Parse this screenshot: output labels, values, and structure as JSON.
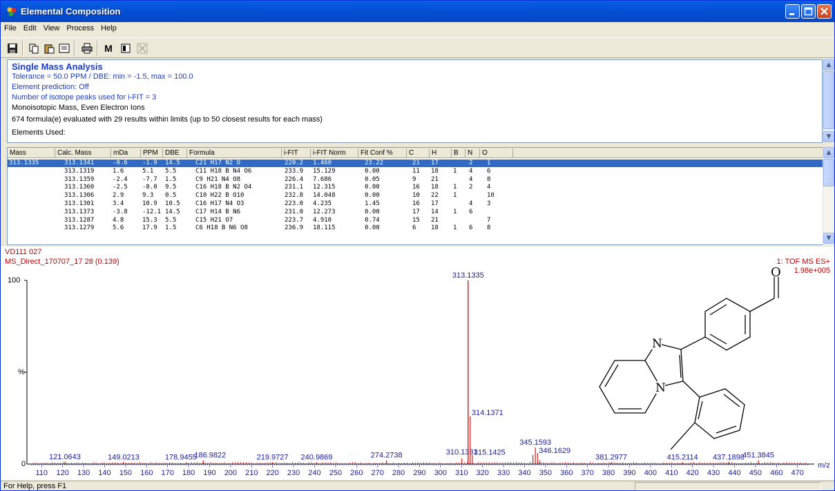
{
  "window": {
    "title": "Elemental Composition"
  },
  "menu": [
    "File",
    "Edit",
    "View",
    "Process",
    "Help"
  ],
  "toolbar": {
    "icons": [
      "save-icon",
      "copy-icon",
      "paste-icon",
      "properties-icon",
      "print-icon",
      "m-icon",
      "view-icon",
      "close-x-icon"
    ],
    "m_label": "M"
  },
  "info": {
    "title": "Single Mass Analysis",
    "tolerance": "Tolerance = 50.0 PPM   /   DBE: min = -1.5, max = 100.0",
    "prediction": "Element prediction: Off",
    "isotope": "Number of isotope peaks used for i-FIT = 3",
    "mode": "Monoisotopic Mass, Even Electron Ions",
    "summary": "674 formula(e) evaluated with 29 results within limits (up to 50 closest results for each mass)",
    "elements": "Elements Used:"
  },
  "grid": {
    "headers": [
      "Mass",
      "Calc. Mass",
      "mDa",
      "PPM",
      "DBE",
      "Formula",
      "i-FIT",
      "i-FIT Norm",
      "Fit Conf %",
      "C",
      "H",
      "B",
      "N",
      "O"
    ],
    "rows": [
      [
        "313.1335",
        "313.1341",
        "-0.6",
        "-1.9",
        "14.5",
        "C21 H17 N2 O",
        "220.2",
        "1.460",
        "23.22",
        "21",
        "17",
        "",
        "2",
        "1"
      ],
      [
        "",
        "313.1319",
        "1.6",
        "5.1",
        "5.5",
        "C11 H18 B N4 O6",
        "233.9",
        "15.129",
        "0.00",
        "11",
        "18",
        "1",
        "4",
        "6"
      ],
      [
        "",
        "313.1359",
        "-2.4",
        "-7.7",
        "1.5",
        "C9 H21 N4 O8",
        "226.4",
        "7.686",
        "0.05",
        "9",
        "21",
        "",
        "4",
        "8"
      ],
      [
        "",
        "313.1360",
        "-2.5",
        "-8.0",
        "9.5",
        "C16 H18 B N2 O4",
        "231.1",
        "12.315",
        "0.00",
        "16",
        "18",
        "1",
        "2",
        "4"
      ],
      [
        "",
        "313.1306",
        "2.9",
        "9.3",
        "0.5",
        "C10 H22 B O10",
        "232.8",
        "14.048",
        "0.00",
        "10",
        "22",
        "1",
        "",
        "10"
      ],
      [
        "",
        "313.1301",
        "3.4",
        "10.9",
        "10.5",
        "C16 H17 N4 O3",
        "223.0",
        "4.235",
        "1.45",
        "16",
        "17",
        "",
        "4",
        "3"
      ],
      [
        "",
        "313.1373",
        "-3.8",
        "-12.1",
        "14.5",
        "C17 H14 B N6",
        "231.0",
        "12.273",
        "0.00",
        "17",
        "14",
        "1",
        "6",
        ""
      ],
      [
        "",
        "313.1287",
        "4.8",
        "15.3",
        "5.5",
        "C15 H21 O7",
        "223.7",
        "4.910",
        "0.74",
        "15",
        "21",
        "",
        "",
        "7"
      ],
      [
        "",
        "313.1279",
        "5.6",
        "17.9",
        "1.5",
        "C6 H18 B N6 O8",
        "236.9",
        "18.115",
        "0.00",
        "6",
        "18",
        "1",
        "6",
        "8"
      ]
    ]
  },
  "spectrum": {
    "sample": "VD111 027",
    "file": "MS_Direct_170707_17 28 (0.139)",
    "mode": "1: TOF MS ES+",
    "intensity": "1.98e+005",
    "y_top": "100",
    "y_mid": "%",
    "y_zero": "0",
    "x_unit": "m/z",
    "colors": {
      "peak": "#e00000",
      "axis_label": "#1a1aa0"
    }
  },
  "chart_data": {
    "type": "bar",
    "xlabel": "m/z",
    "xlim": [
      103,
      478
    ],
    "ylim": [
      0,
      100
    ],
    "x_ticks": [
      110,
      120,
      130,
      140,
      150,
      160,
      170,
      180,
      190,
      200,
      210,
      220,
      230,
      240,
      250,
      260,
      270,
      280,
      290,
      300,
      310,
      320,
      330,
      340,
      350,
      360,
      370,
      380,
      390,
      400,
      410,
      420,
      430,
      440,
      450,
      460,
      470
    ],
    "peaks": [
      {
        "mz": 121.0643,
        "rel": 1.2,
        "label": "121.0643"
      },
      {
        "mz": 149.0213,
        "rel": 1.0,
        "label": "149.0213"
      },
      {
        "mz": 178.9455,
        "rel": 1.0,
        "label": "178.9455"
      },
      {
        "mz": 186.9822,
        "rel": 2.0,
        "label": "186.9822"
      },
      {
        "mz": 219.9727,
        "rel": 1.0,
        "label": "219.9727"
      },
      {
        "mz": 240.9869,
        "rel": 1.0,
        "label": "240.9869"
      },
      {
        "mz": 274.2738,
        "rel": 2.0,
        "label": "274.2738"
      },
      {
        "mz": 310.1331,
        "rel": 3.0,
        "label": "310.1331"
      },
      {
        "mz": 313.1335,
        "rel": 100,
        "label": "313.1335"
      },
      {
        "mz": 314.1371,
        "rel": 26,
        "label": "314.1371"
      },
      {
        "mz": 315.1425,
        "rel": 5,
        "label": "315.1425"
      },
      {
        "mz": 345.1593,
        "rel": 9,
        "label": "345.1593"
      },
      {
        "mz": 344.0,
        "rel": 5,
        "label": ""
      },
      {
        "mz": 346.1629,
        "rel": 6,
        "label": "346.1629"
      },
      {
        "mz": 347.2,
        "rel": 2,
        "label": ""
      },
      {
        "mz": 381.2977,
        "rel": 1.0,
        "label": "381.2977"
      },
      {
        "mz": 415.2114,
        "rel": 1.0,
        "label": "415.2114"
      },
      {
        "mz": 437.1898,
        "rel": 1.0,
        "label": "437.1898"
      },
      {
        "mz": 451.3845,
        "rel": 2.0,
        "label": "451.3845"
      }
    ]
  },
  "structure": {
    "atom_n1": "N",
    "atom_n2": "N",
    "atom_o": "O"
  },
  "status": {
    "text": "For Help, press F1"
  }
}
